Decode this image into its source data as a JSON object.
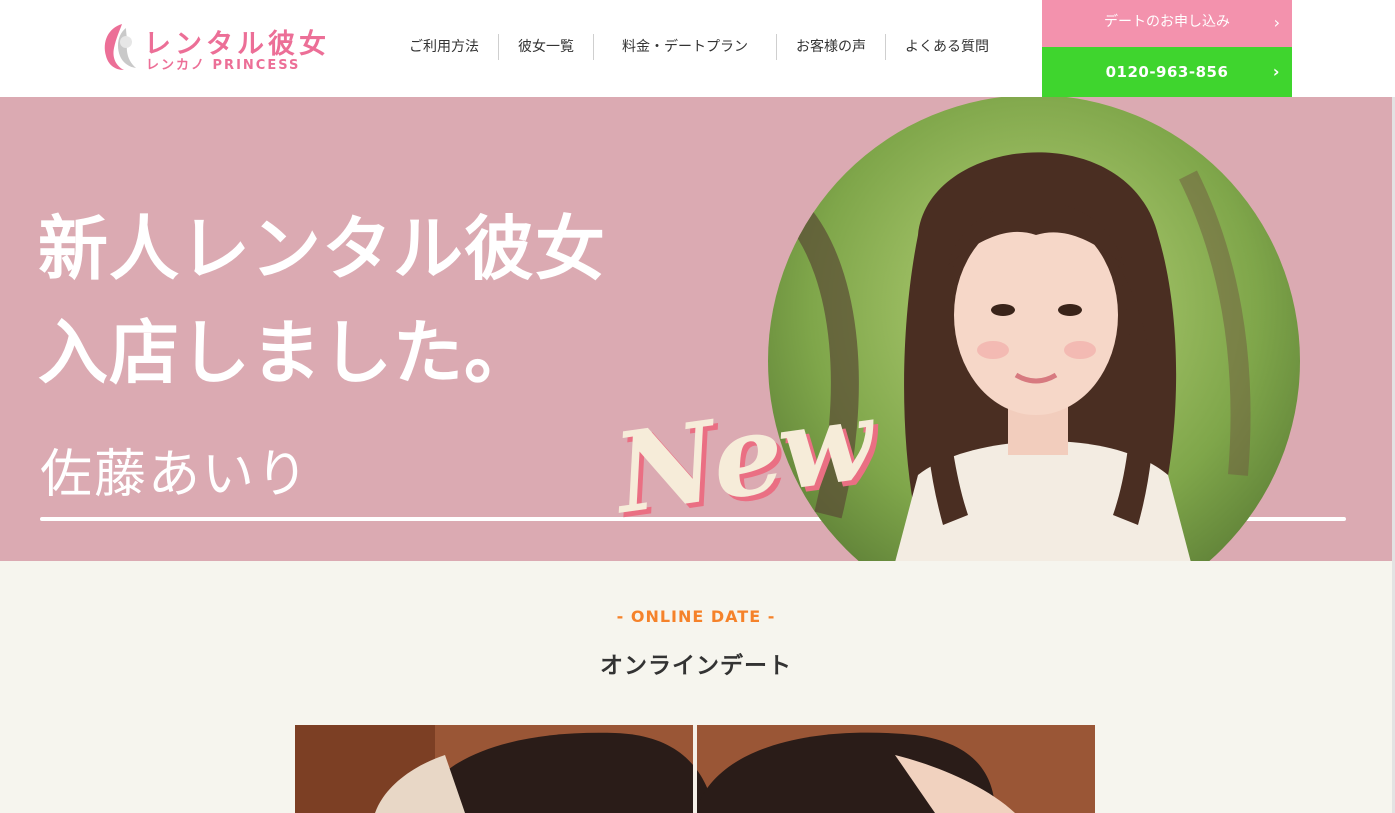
{
  "brand": {
    "logo_main": "レンタル彼女",
    "logo_sub": "レンカノ PRINCESS"
  },
  "nav": {
    "items": [
      {
        "label": "ご利用方法"
      },
      {
        "label": "彼女一覧"
      },
      {
        "label": "料金・デートプラン"
      },
      {
        "label": "お客様の声"
      },
      {
        "label": "よくある質問"
      }
    ]
  },
  "cta": {
    "apply_label": "デートのお申し込み",
    "phone_label": "0120-963-856",
    "chevron": "›"
  },
  "hero": {
    "line1": "新人レンタル彼女",
    "line2": "入店しました。",
    "name": "佐藤あいり",
    "badge": "New"
  },
  "online": {
    "subtitle": "- ONLINE DATE -",
    "title": "オンラインデート"
  },
  "colors": {
    "brand_pink": "#ec6f97",
    "apply_bg": "#f392ad",
    "phone_bg": "#3fd52e",
    "hero_bg": "#dbaab2",
    "section_accent": "#f5822a"
  }
}
